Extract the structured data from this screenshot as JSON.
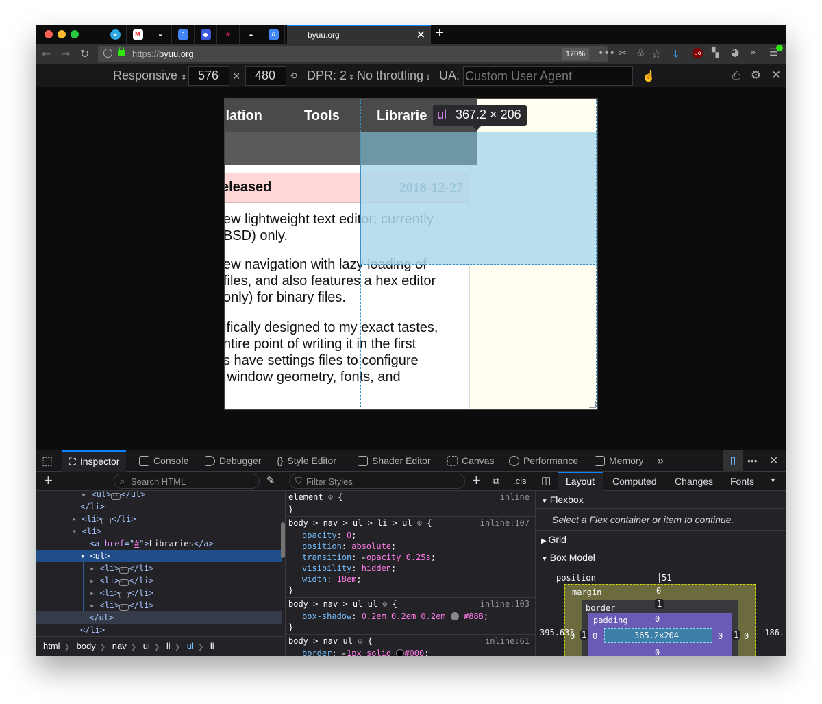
{
  "browser": {
    "tab_title": "byuu.org",
    "url_scheme": "https://",
    "url_host": "byuu.org",
    "zoom": "170%",
    "pinned_tabs": [
      "telegram-icon",
      "gmail-icon",
      "lock-icon",
      "calendar-icon",
      "record-icon",
      "slack-icon",
      "cloud-icon",
      "calendar-icon"
    ],
    "pinned_labels": [
      "6",
      "6"
    ]
  },
  "rdm": {
    "device": "Responsive",
    "width": "576",
    "times": "×",
    "height": "480",
    "dpr": "DPR: 2",
    "throttling": "No throttling",
    "ua_label": "UA:",
    "ua_placeholder": "Custom User Agent"
  },
  "page": {
    "nav": [
      "ılation",
      "Tools",
      "Librarie"
    ],
    "news_title": "eleased",
    "news_date": "2018-12-27",
    "para1": [
      "ew lightweight text editor; currently",
      "BSD) only."
    ],
    "para2": [
      "ew navigation with lazy loading of",
      "files, and also features a hex editor",
      "only) for binary files."
    ],
    "para3": [
      "ifically designed to my exact tastes,",
      "ntire point of writing it in the first",
      "s have settings files to configure",
      " window geometry, fonts, and"
    ]
  },
  "tooltip": {
    "tag": "ul",
    "size": "367.2 × 206"
  },
  "devtools": {
    "tabs": [
      "Inspector",
      "Console",
      "Debugger",
      "Style Editor",
      "Shader Editor",
      "Canvas",
      "Performance",
      "Memory"
    ],
    "search_html": "Search HTML",
    "filter_styles": "Filter Styles",
    "cls": ".cls",
    "tree": {
      "r0_open": "<ul>",
      "r0_close": "</ul>",
      "r1": "</li>",
      "r2_open": "<li>",
      "r2_close": "</li>",
      "r3": "<li>",
      "r4_a_open": "<a ",
      "r4_attr": "href",
      "r4_eq": "=\"",
      "r4_val": "#",
      "r4_q": "\">",
      "r4_text": "Libraries",
      "r4_a_close": "</a>",
      "r5": "<ul>",
      "li_open": "<li>",
      "li_close": "</li>",
      "r10": "</ul>",
      "r11": "</li>"
    },
    "breadcrumbs": [
      "html",
      "body",
      "nav",
      "ul",
      "li",
      "ul",
      "li"
    ],
    "rules": {
      "element_sel": "element",
      "element_src": "inline",
      "close": "}",
      "rule1_sel": "body > nav > ul > li > ul",
      "rule1_src": "inline:107",
      "rule1_props": [
        {
          "name": "opacity",
          "value": "0"
        },
        {
          "name": "position",
          "value": "absolute"
        },
        {
          "name": "transition",
          "value": "opacity 0.25s"
        },
        {
          "name": "visibility",
          "value": "hidden"
        },
        {
          "name": "width",
          "value": "18em"
        }
      ],
      "rule2_sel": "body > nav > ul ul",
      "rule2_src": "inline:103",
      "rule2_prop": "box-shadow",
      "rule2_val": "0.2em 0.2em 0.2em",
      "rule2_color": "#888",
      "rule3_sel": "body > nav ul",
      "rule3_src": "inline:61",
      "rule3_prop": "border",
      "rule3_val": "1px solid",
      "rule3_color": "#000"
    },
    "right_tabs": [
      "Layout",
      "Computed",
      "Changes",
      "Fonts"
    ],
    "flexbox": "Flexbox",
    "flex_hint": "Select a Flex container or item to continue.",
    "grid": "Grid",
    "box_model": "Box Model",
    "box": {
      "position_label": "position",
      "position_top": "51",
      "margin_label": "margin",
      "margin_top": "0",
      "border_label": "border",
      "border_top": "1",
      "padding_label": "padding",
      "padding_top": "0",
      "content": "365.2×204",
      "left_pos": "395.633",
      "right_pos": "-186.",
      "margin_left": "0",
      "border_left": "1",
      "padding_left": "0",
      "padding_right": "0",
      "border_right": "1",
      "margin_right": "0",
      "padding_bottom": "0"
    }
  },
  "colors": {
    "accent": "#0a84ff",
    "highlight": "#add8eb",
    "news_head": "#ffd7d7",
    "date": "#2d6275"
  }
}
